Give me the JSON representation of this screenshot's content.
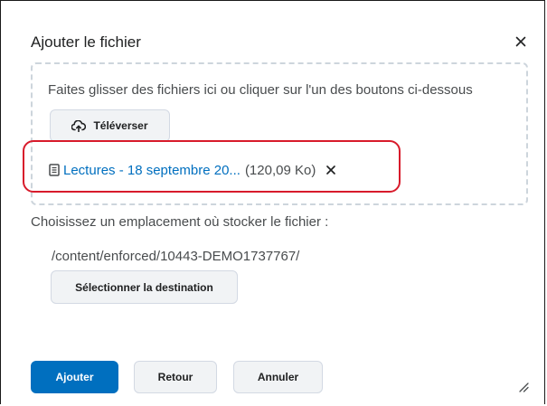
{
  "dialog": {
    "title": "Ajouter le fichier",
    "close_icon": "close-icon"
  },
  "dropzone": {
    "hint": "Faites glisser des fichiers ici ou cliquer sur l'un des boutons ci-dessous",
    "upload_label": "Téléverser",
    "upload_icon": "cloud-upload-icon"
  },
  "file": {
    "icon": "document-icon",
    "name": "Lectures - 18 septembre 20...",
    "size": "(120,09 Ko)",
    "remove_icon": "remove-icon",
    "highlight_color": "#d81b2b"
  },
  "location": {
    "label": "Choisissez un emplacement où stocker le fichier :",
    "path": "/content/enforced/10443-DEMO1737767/",
    "select_label": "Sélectionner la destination"
  },
  "footer": {
    "add_label": "Ajouter",
    "back_label": "Retour",
    "cancel_label": "Annuler"
  },
  "colors": {
    "primary": "#006fbf",
    "link": "#006fbf"
  }
}
